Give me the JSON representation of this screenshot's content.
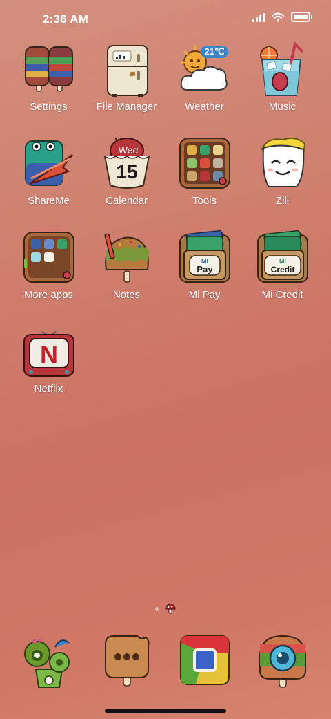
{
  "status_bar": {
    "time": "2:36 AM"
  },
  "apps": [
    {
      "name": "settings",
      "label": "Settings"
    },
    {
      "name": "file-manager",
      "label": "File Manager"
    },
    {
      "name": "weather",
      "label": "Weather",
      "badge": "21℃"
    },
    {
      "name": "music",
      "label": "Music"
    },
    {
      "name": "shareme",
      "label": "ShareMe"
    },
    {
      "name": "calendar",
      "label": "Calendar",
      "day": "Wed",
      "date": "15"
    },
    {
      "name": "tools",
      "label": "Tools"
    },
    {
      "name": "zili",
      "label": "Zili"
    },
    {
      "name": "more-apps",
      "label": "More apps"
    },
    {
      "name": "notes",
      "label": "Notes"
    },
    {
      "name": "mi-pay",
      "label": "Mi Pay",
      "badge_top": "MI",
      "badge_bottom": "Pay"
    },
    {
      "name": "mi-credit",
      "label": "Mi Credit",
      "badge_top": "MI",
      "badge_bottom": "Credit"
    },
    {
      "name": "netflix",
      "label": "Netflix",
      "letter": "N"
    }
  ],
  "dock": [
    {
      "name": "phone",
      "icon": "cactus-phone-icon"
    },
    {
      "name": "messages",
      "icon": "chat-bubble-icon"
    },
    {
      "name": "browser",
      "icon": "browser-icon"
    },
    {
      "name": "camera",
      "icon": "camera-icon"
    }
  ],
  "colors": {
    "wallpaper": "#cf7e6d",
    "label": "#ffffff"
  }
}
